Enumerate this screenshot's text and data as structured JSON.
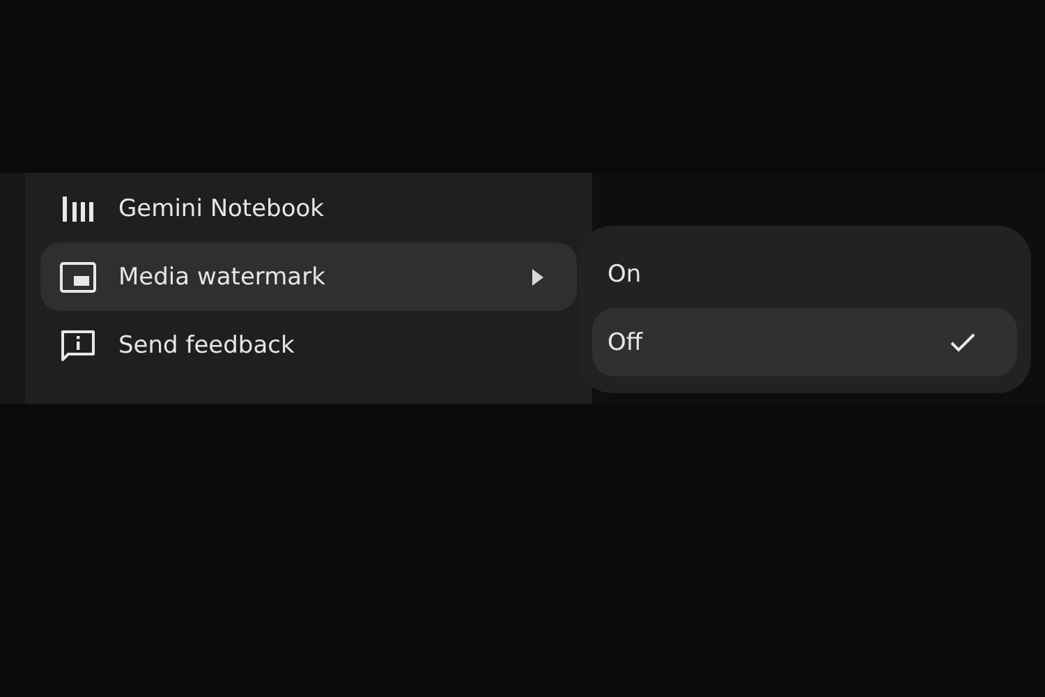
{
  "menu": {
    "items": [
      {
        "label": "Gemini Notebook",
        "selected": false,
        "submenu": false
      },
      {
        "label": "Media watermark",
        "selected": true,
        "submenu": true
      },
      {
        "label": "Send feedback",
        "selected": false,
        "submenu": false
      }
    ]
  },
  "submenu": {
    "options": [
      {
        "label": "On",
        "selected": false
      },
      {
        "label": "Off",
        "selected": true
      }
    ]
  }
}
